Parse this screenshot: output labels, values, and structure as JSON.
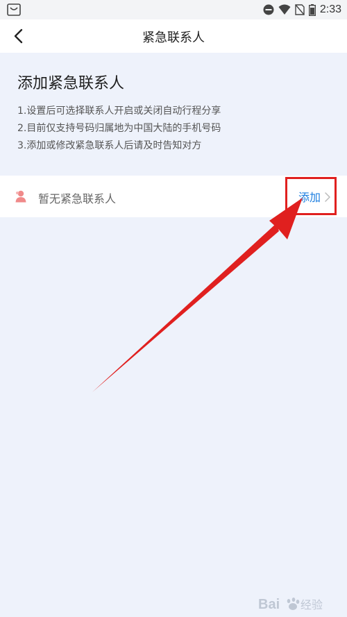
{
  "status_bar": {
    "time": "2:33",
    "icons": [
      "shopping-bag-icon",
      "do-not-disturb-icon",
      "wifi-icon",
      "no-sim-icon",
      "battery-icon"
    ]
  },
  "nav": {
    "title": "紧急联系人",
    "back_icon": "chevron-left-icon"
  },
  "info": {
    "heading": "添加紧急联系人",
    "lines": [
      "1.设置后可选择联系人开启或关闭自动行程分享",
      "2.目前仅支持号码归属地为中国大陆的手机号码",
      "3.添加或修改紧急联系人后请及时告知对方"
    ]
  },
  "contact": {
    "empty_text": "暂无紧急联系人",
    "add_label": "添加",
    "icon": "person-icon"
  },
  "watermark": {
    "text": "Baidu经验"
  },
  "colors": {
    "background": "#eef2fb",
    "accent": "#1e7fe0",
    "annotation": "#e0201f",
    "contact_icon": "#f08a8a"
  }
}
